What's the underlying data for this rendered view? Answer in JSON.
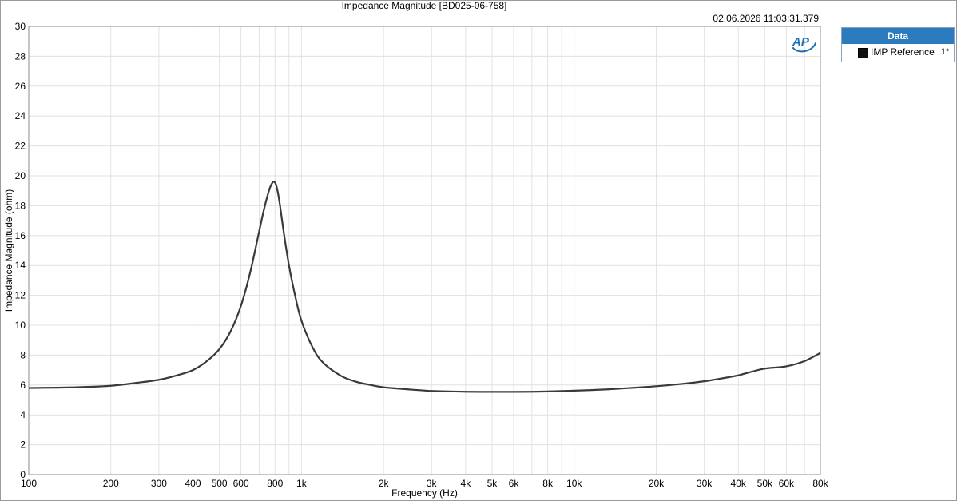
{
  "window": {
    "title": "Impedance Magnitude [BD025-06-758]",
    "timestamp": "02.06.2026 11:03:31.379"
  },
  "logo": {
    "text": "AP",
    "color": "#1f6fb5"
  },
  "legend": {
    "header": "Data",
    "header_color": "#2c7bbf",
    "items": [
      {
        "name": "IMP Reference",
        "channel": "1*",
        "color": "#111111"
      }
    ]
  },
  "chart_data": {
    "type": "line",
    "title": "Impedance Magnitude [BD025-06-758]",
    "xlabel": "Frequency (Hz)",
    "ylabel": "Impedance Magnitude (ohm)",
    "xscale": "log",
    "xlim": [
      100,
      80000
    ],
    "ylim": [
      0,
      30
    ],
    "grid": true,
    "x_ticks": [
      100,
      200,
      300,
      400,
      500,
      600,
      800,
      1000,
      2000,
      3000,
      4000,
      5000,
      6000,
      8000,
      10000,
      20000,
      30000,
      40000,
      50000,
      60000,
      80000
    ],
    "x_tick_labels": [
      "100",
      "200",
      "300",
      "400",
      "500",
      "600",
      "800",
      "1k",
      "2k",
      "3k",
      "4k",
      "5k",
      "6k",
      "8k",
      "10k",
      "20k",
      "30k",
      "40k",
      "50k",
      "60k",
      "80k"
    ],
    "y_ticks": [
      0,
      2,
      4,
      6,
      8,
      10,
      12,
      14,
      16,
      18,
      20,
      22,
      24,
      26,
      28,
      30
    ],
    "y_tick_labels": [
      "0",
      "2",
      "4",
      "6",
      "8",
      "10",
      "12",
      "14",
      "16",
      "18",
      "20",
      "22",
      "24",
      "26",
      "28",
      "30"
    ],
    "series": [
      {
        "name": "IMP Reference",
        "color": "#3a3a3a",
        "x": [
          100,
          150,
          200,
          250,
          300,
          350,
          400,
          450,
          500,
          550,
          600,
          650,
          700,
          730,
          760,
          780,
          795,
          810,
          830,
          860,
          900,
          950,
          1000,
          1100,
          1200,
          1400,
          1600,
          1800,
          2000,
          2500,
          3000,
          3500,
          4000,
          5000,
          6000,
          7000,
          8000,
          10000,
          13000,
          16000,
          20000,
          25000,
          30000,
          35000,
          40000,
          45000,
          50000,
          60000,
          70000,
          80000
        ],
        "y": [
          5.8,
          5.85,
          5.95,
          6.15,
          6.35,
          6.65,
          7.0,
          7.6,
          8.4,
          9.6,
          11.3,
          13.6,
          16.3,
          17.8,
          19.0,
          19.5,
          19.6,
          19.3,
          18.3,
          16.3,
          14.0,
          11.9,
          10.3,
          8.5,
          7.5,
          6.6,
          6.2,
          6.0,
          5.85,
          5.7,
          5.6,
          5.57,
          5.55,
          5.54,
          5.54,
          5.55,
          5.57,
          5.62,
          5.7,
          5.8,
          5.92,
          6.08,
          6.25,
          6.45,
          6.65,
          6.9,
          7.1,
          7.25,
          7.6,
          8.15
        ]
      }
    ]
  }
}
